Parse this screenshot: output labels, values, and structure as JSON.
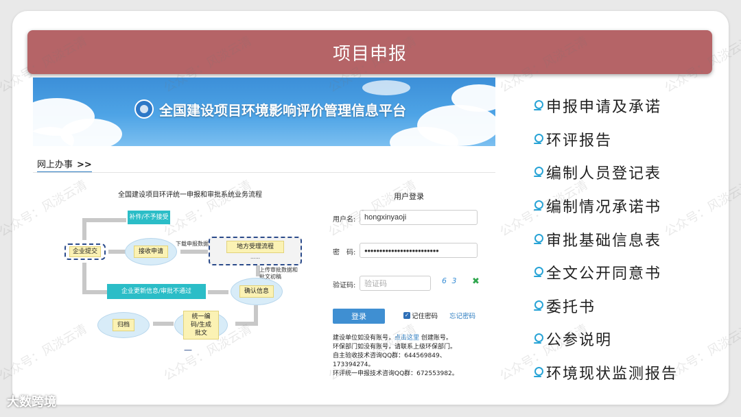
{
  "slide": {
    "title": "项目申报",
    "items": [
      "申报申请及承诺",
      "环评报告",
      "编制人员登记表",
      "编制情况承诺书",
      "审批基础信息表",
      "全文公开同意书",
      "委托书",
      "公参说明",
      "环境现状监测报告"
    ]
  },
  "screenshot": {
    "banner_title": "全国建设项目环境影响评价管理信息平台",
    "online_tab": "网上办事",
    "online_tab_arrow": ">>",
    "flow": {
      "title": "全国建设项目环评统一申报和审批系统业务流程",
      "nodes": {
        "supplement": "补件/不予接受",
        "submit": "企业提交",
        "accept": "接收申请",
        "download": "下载申报数据",
        "local_flow": "地方受理流程",
        "local_flow_sub": "……",
        "upload": "上传审批数据和批文初稿",
        "confirm": "确认信息",
        "update": "企业更新信息/审批不通过",
        "code": "统一编码/生成批文",
        "archive": "归档",
        "dash": "—"
      }
    },
    "login": {
      "title": "用户登录",
      "username_label": "用户名:",
      "username_value": "hongxinyaoji",
      "password_label": "密　码:",
      "password_value": "●●●●●●●●●●●●●●●●●●●●●●●●●",
      "captcha_label": "验证码:",
      "captcha_placeholder": "验证码",
      "captcha_text": "6 3",
      "refresh": "✖",
      "login_button": "登录",
      "remember_label": "记住密码",
      "forgot_label": "忘记密码",
      "info_1a": "建设单位如没有账号，",
      "info_1link": "点击这里",
      "info_1b": " 创建账号。",
      "info_2": "环保部门如没有账号，请联系上级环保部门。",
      "info_3": "自主验收技术咨询QQ群：644569849、",
      "info_4": "173394274。",
      "info_5": "环评统一申报技术咨询QQ群：672553982。"
    }
  },
  "watermark": "公众号：风淡云清",
  "brand": "大数跨境",
  "colors": {
    "title_bar": "#b56467",
    "pin": "#27a3d6",
    "teal": "#2bbdc7",
    "link": "#2a7bc0"
  }
}
